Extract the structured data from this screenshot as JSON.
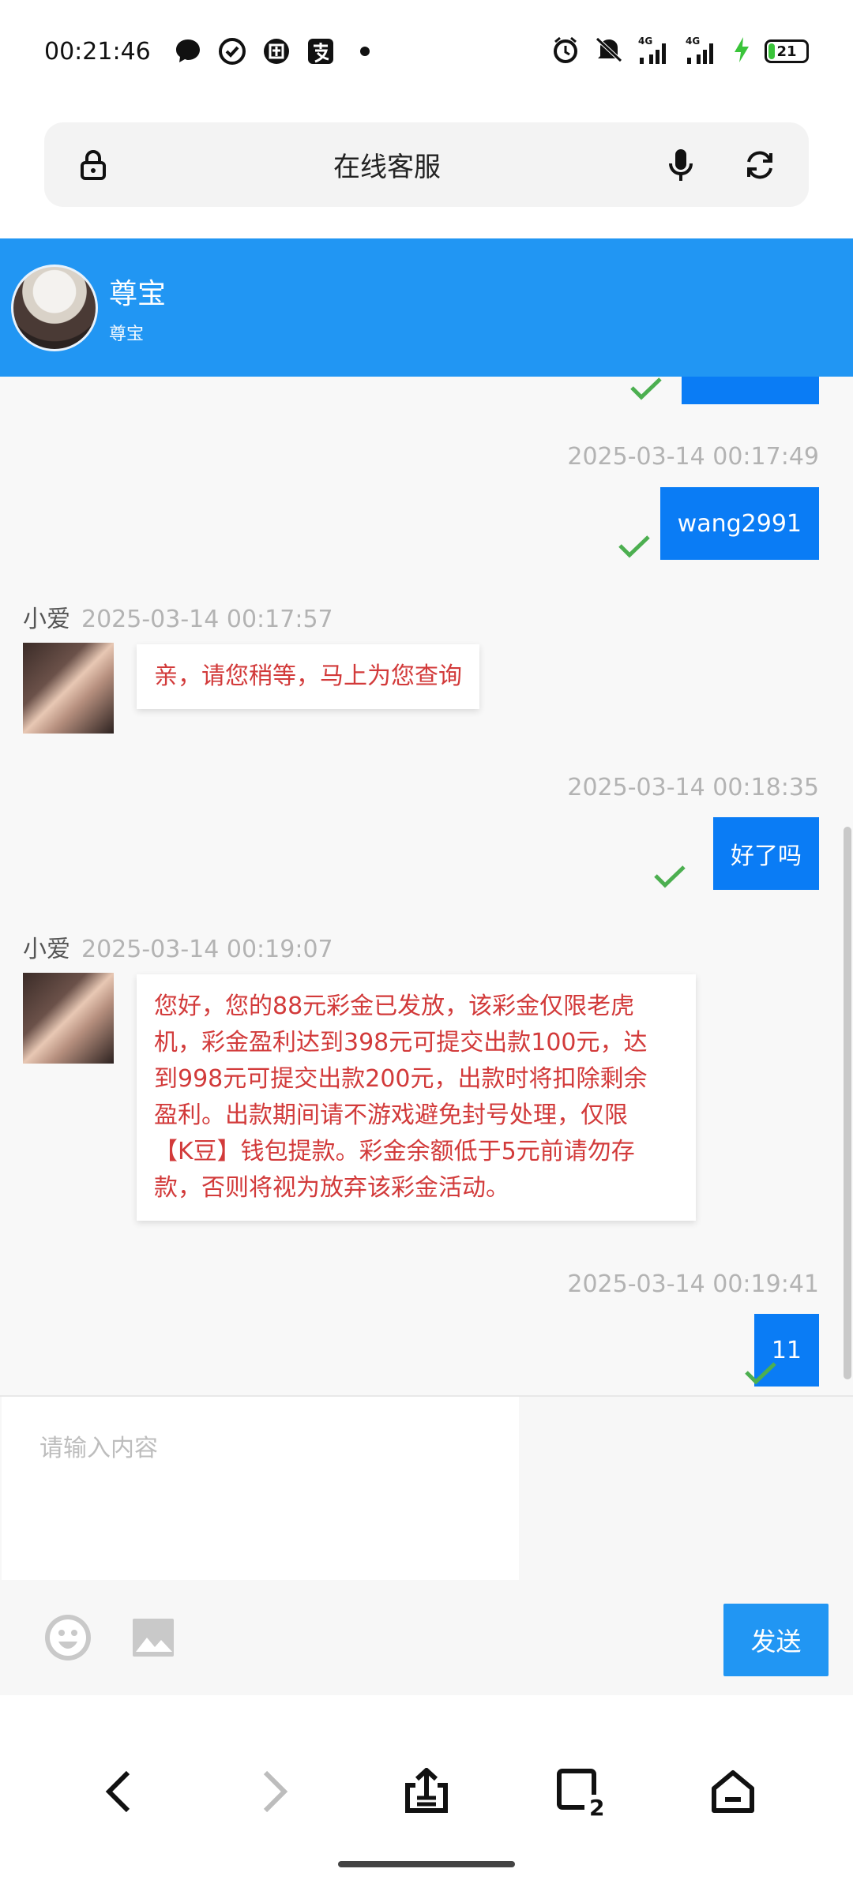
{
  "status_bar": {
    "time": "00:21:46",
    "battery": "21",
    "left_icons": [
      "chat-bubble-icon",
      "check-circle-icon",
      "tuan-app-icon",
      "alipay-icon",
      "dot-icon"
    ],
    "right_icons": [
      "alarm-icon",
      "silent-icon",
      "signal-4g-icon",
      "signal-4g-icon",
      "charging-icon",
      "battery-icon"
    ],
    "network_label_1": "4G",
    "network_label_2": "4G"
  },
  "urlbar": {
    "title": "在线客服"
  },
  "chat_header": {
    "name": "尊宝",
    "subtitle": "尊宝"
  },
  "messages": {
    "out_1": {
      "time": "2025-03-14 00:17:49",
      "text": "wang2991"
    },
    "in_1": {
      "sender": "小爱",
      "time": "2025-03-14 00:17:57",
      "text": "亲，请您稍等，马上为您查询"
    },
    "out_2": {
      "time": "2025-03-14 00:18:35",
      "text": "好了吗"
    },
    "in_2": {
      "sender": "小爱",
      "time": "2025-03-14 00:19:07",
      "lines": [
        "您好，您的88元彩金已发放，该彩金仅限老虎",
        "机，彩金盈利达到398元可提交出款100元，达",
        "到998元可提交出款200元，出款时将扣除剩余",
        "盈利。出款期间请不游戏避免封号处理，仅限",
        "【K豆】钱包提款。彩金余额低于5元前请勿存",
        "款，否则将视为放弃该彩金活动。"
      ]
    },
    "out_3": {
      "time": "2025-03-14 00:19:41",
      "text": "11"
    }
  },
  "input": {
    "placeholder": "请输入内容",
    "send_label": "发送"
  },
  "colors": {
    "header_blue": "#2196f3",
    "bubble_out": "#0a7cf5",
    "incoming_text": "#d23a3a",
    "check_green": "#4caf50"
  }
}
